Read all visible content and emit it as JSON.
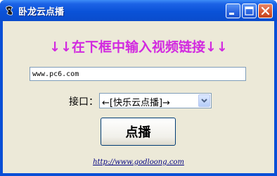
{
  "window": {
    "title": "卧龙云点播"
  },
  "main": {
    "headline": "↓↓在下框中输入视频链接↓↓",
    "url_input": {
      "value": "www.pc6.com",
      "placeholder": ""
    },
    "interface": {
      "label": "接口：",
      "selected": "←[快乐云点播]→"
    },
    "play_button_label": "点播",
    "footer_link": "http://www.godloong.com"
  },
  "colors": {
    "headline": "#d22ae0",
    "titlebar": "#0a52d8",
    "client_bg": "#ece9d8",
    "link": "#000080"
  },
  "icons": [
    "app-logo-icon",
    "minimize-icon",
    "maximize-icon",
    "close-icon",
    "chevron-down-icon"
  ]
}
